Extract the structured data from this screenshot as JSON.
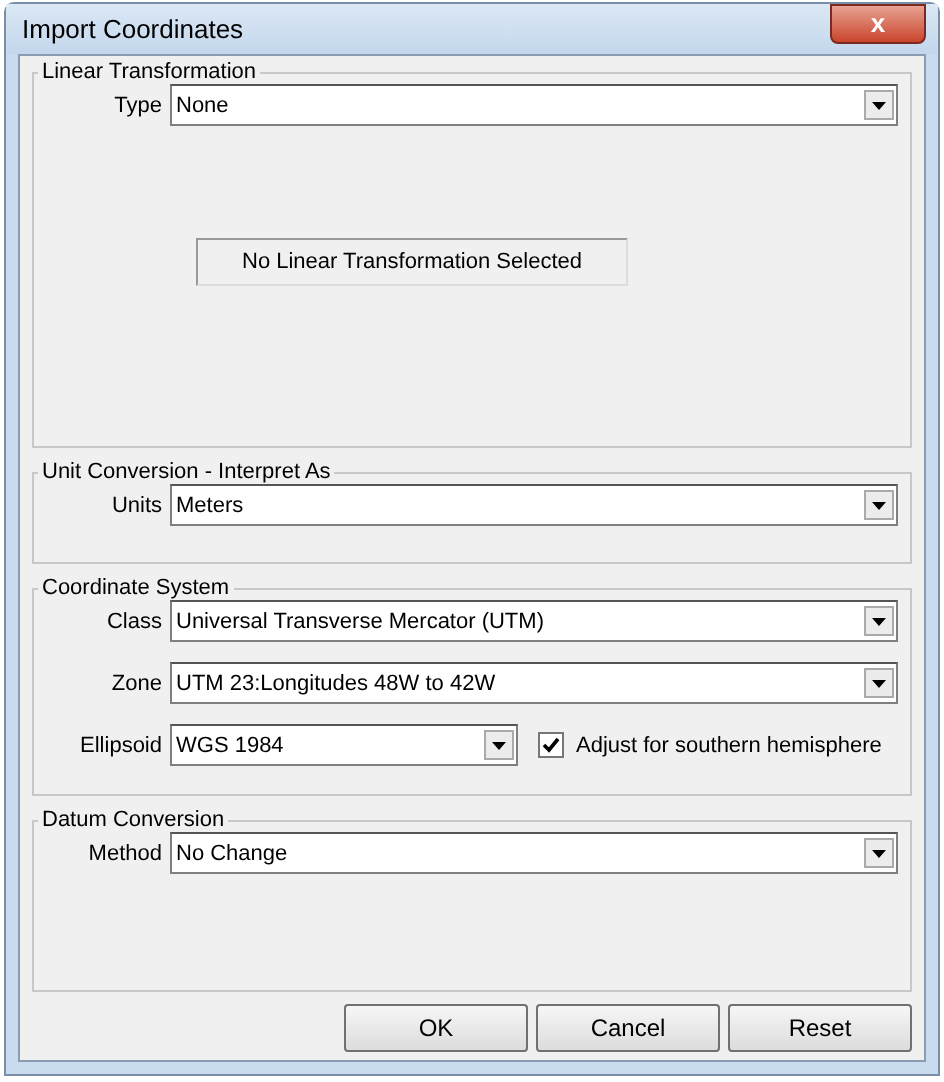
{
  "window": {
    "title": "Import Coordinates",
    "close_label": "x"
  },
  "groups": [
    {
      "title": "Linear Transformation",
      "fields": [
        {
          "label": "Type",
          "value": "None"
        }
      ],
      "status_text": "No Linear Transformation Selected"
    },
    {
      "title": "Unit Conversion - Interpret As",
      "fields": [
        {
          "label": "Units",
          "value": "Meters"
        }
      ]
    },
    {
      "title": "Coordinate System",
      "fields": [
        {
          "label": "Class",
          "value": "Universal Transverse Mercator (UTM)"
        },
        {
          "label": "Zone",
          "value": "UTM 23:Longitudes 48W to 42W"
        },
        {
          "label": "Ellipsoid",
          "value": "WGS 1984",
          "checkbox": {
            "label": "Adjust for southern hemisphere",
            "checked": true
          }
        }
      ]
    },
    {
      "title": "Datum Conversion",
      "fields": [
        {
          "label": "Method",
          "value": "No Change"
        }
      ]
    }
  ],
  "buttons": [
    "OK",
    "Cancel",
    "Reset"
  ]
}
